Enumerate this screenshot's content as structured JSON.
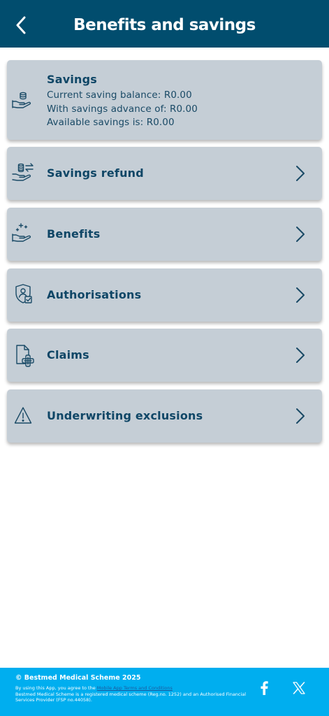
{
  "header": {
    "title": "Benefits and savings",
    "back_icon": "chevron-left-icon"
  },
  "savings": {
    "title": "Savings",
    "icon": "hand-coins-icon",
    "lines": [
      "Current saving balance: R0.00",
      "With savings advance of: R0.00",
      "Available savings is: R0.00"
    ]
  },
  "menu": [
    {
      "label": "Savings refund",
      "icon": "hand-coins-transfer-icon"
    },
    {
      "label": "Benefits",
      "icon": "hand-sparkles-icon"
    },
    {
      "label": "Authorisations",
      "icon": "shield-person-check-icon"
    },
    {
      "label": "Claims",
      "icon": "document-plus-icon"
    },
    {
      "label": "Underwriting exclusions",
      "icon": "warning-triangle-icon"
    }
  ],
  "footer": {
    "copyright": "© Bestmed Medical Scheme 2025",
    "terms_prefix": "By using this App, you agree to the ",
    "terms_link": "Mobile App Terms and Conditions",
    "registration": "Bestmed Medical Scheme is a registered medical scheme (Reg.no. 1252) and an Authorised Financial Services Provider (FSP no.44058).",
    "social": [
      "facebook-icon",
      "x-twitter-icon"
    ]
  },
  "colors": {
    "header_bg": "#014d6e",
    "card_bg": "#c5ced6",
    "text_primary": "#0f4666",
    "footer_bg": "#00aeef"
  }
}
